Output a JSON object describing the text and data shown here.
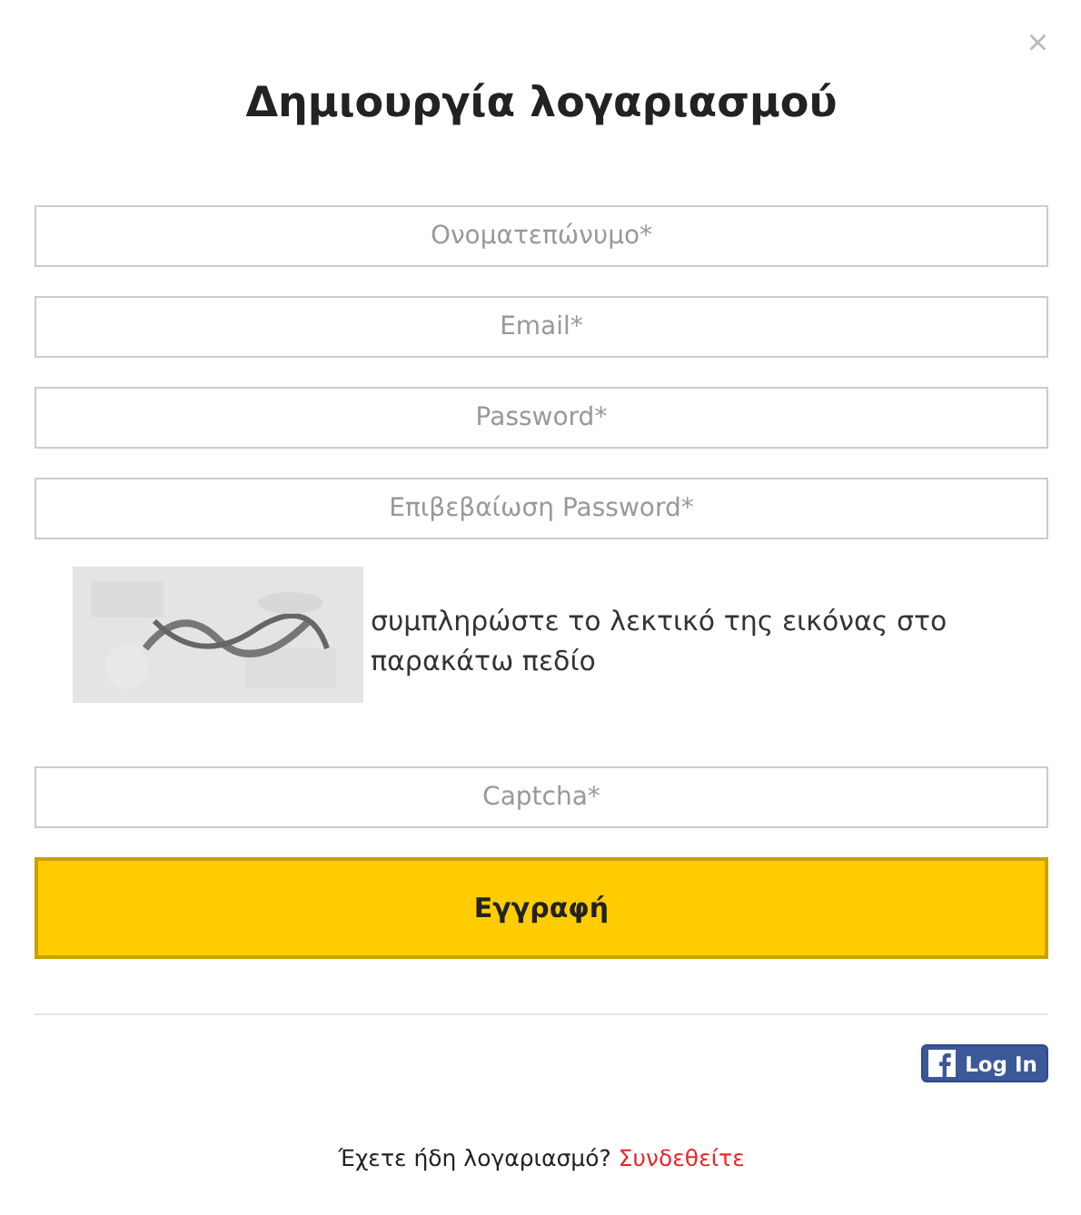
{
  "close": "×",
  "title": "Δημιουργία λογαριασμού",
  "fields": [
    {
      "placeholder": "Ονοματεπώνυμο*"
    },
    {
      "placeholder": "Email*"
    },
    {
      "placeholder": "Password*"
    },
    {
      "placeholder": "Επιβεβαίωση Password*"
    }
  ],
  "captcha": {
    "hint": "συμπληρώστε το λεκτικό της εικόνας στο παρακάτω πεδίο",
    "field": {
      "placeholder": "Captcha*"
    }
  },
  "submit": "Εγγραφή",
  "facebook": {
    "label": "Log In"
  },
  "footer": {
    "text": "Έχετε ήδη λογαριασμό?",
    "link": "Συνδεθείτε"
  }
}
